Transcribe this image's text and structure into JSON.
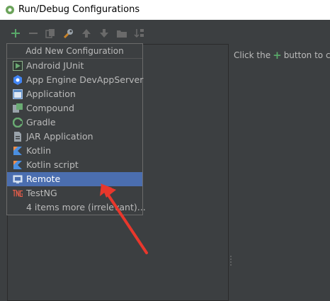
{
  "window": {
    "title": "Run/Debug Configurations"
  },
  "toolbar": {
    "buttons": [
      "add-icon",
      "remove-icon",
      "copy-icon",
      "wrench-icon",
      "move-up-icon",
      "move-down-icon",
      "folder-icon",
      "sort-icon"
    ]
  },
  "hint": {
    "before": "Click the",
    "after": "button to c"
  },
  "popup": {
    "header": "Add New Configuration",
    "items": [
      {
        "label": "Android JUnit",
        "icon": "android-junit-icon"
      },
      {
        "label": "App Engine DevAppServer",
        "icon": "app-engine-icon"
      },
      {
        "label": "Application",
        "icon": "application-icon"
      },
      {
        "label": "Compound",
        "icon": "compound-icon"
      },
      {
        "label": "Gradle",
        "icon": "gradle-icon"
      },
      {
        "label": "JAR Application",
        "icon": "jar-application-icon"
      },
      {
        "label": "Kotlin",
        "icon": "kotlin-icon"
      },
      {
        "label": "Kotlin script",
        "icon": "kotlin-script-icon"
      },
      {
        "label": "Remote",
        "icon": "remote-icon",
        "selected": true
      },
      {
        "label": "TestNG",
        "icon": "testng-icon"
      }
    ],
    "more": "4 items more (irrelevant)..."
  },
  "colors": {
    "background": "#3c3f41",
    "selection": "#4b6eaf",
    "annotation_arrow": "#e8372c",
    "add_green": "#59a869"
  }
}
